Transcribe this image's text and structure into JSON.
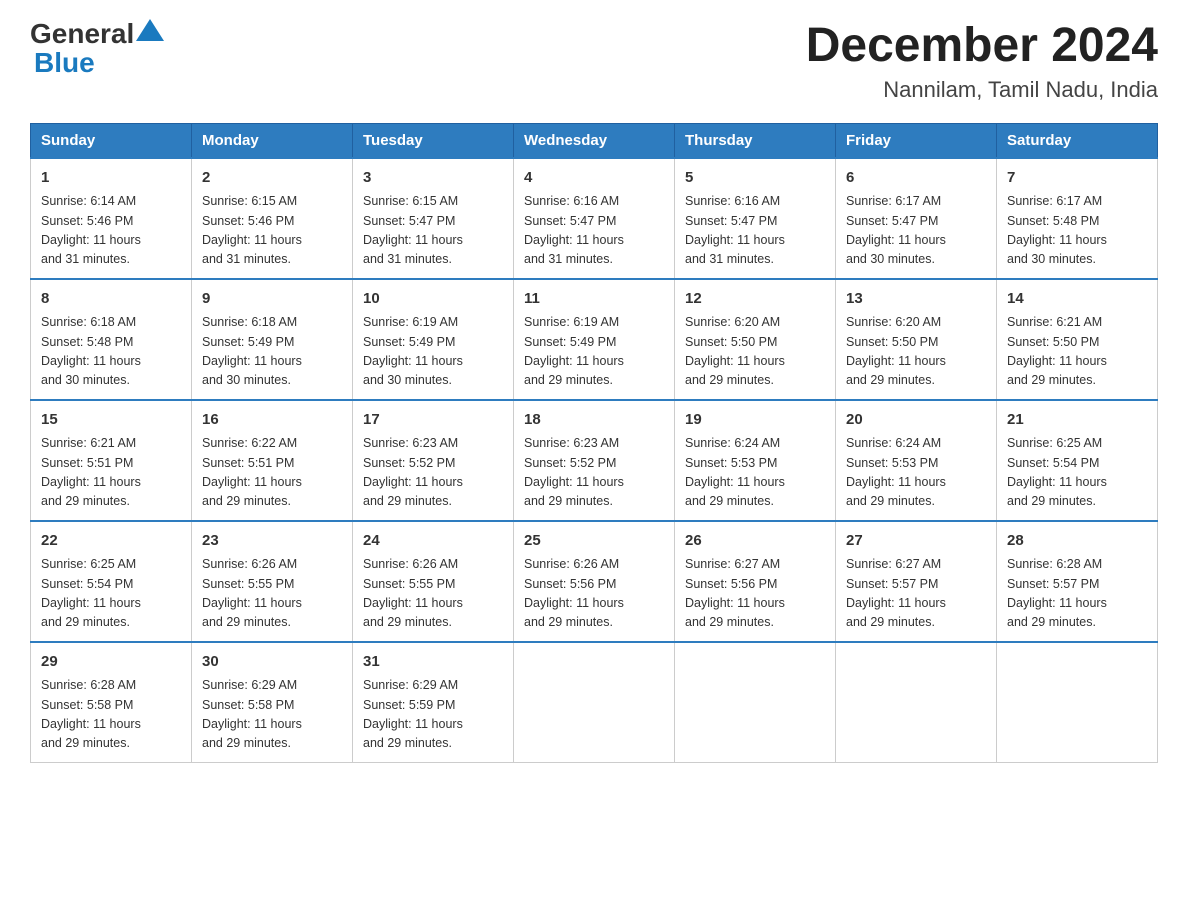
{
  "logo": {
    "line1": "General",
    "line2": "Blue"
  },
  "title": "December 2024",
  "subtitle": "Nannilam, Tamil Nadu, India",
  "headers": [
    "Sunday",
    "Monday",
    "Tuesday",
    "Wednesday",
    "Thursday",
    "Friday",
    "Saturday"
  ],
  "weeks": [
    [
      {
        "day": "1",
        "sunrise": "6:14 AM",
        "sunset": "5:46 PM",
        "daylight": "11 hours and 31 minutes."
      },
      {
        "day": "2",
        "sunrise": "6:15 AM",
        "sunset": "5:46 PM",
        "daylight": "11 hours and 31 minutes."
      },
      {
        "day": "3",
        "sunrise": "6:15 AM",
        "sunset": "5:47 PM",
        "daylight": "11 hours and 31 minutes."
      },
      {
        "day": "4",
        "sunrise": "6:16 AM",
        "sunset": "5:47 PM",
        "daylight": "11 hours and 31 minutes."
      },
      {
        "day": "5",
        "sunrise": "6:16 AM",
        "sunset": "5:47 PM",
        "daylight": "11 hours and 31 minutes."
      },
      {
        "day": "6",
        "sunrise": "6:17 AM",
        "sunset": "5:47 PM",
        "daylight": "11 hours and 30 minutes."
      },
      {
        "day": "7",
        "sunrise": "6:17 AM",
        "sunset": "5:48 PM",
        "daylight": "11 hours and 30 minutes."
      }
    ],
    [
      {
        "day": "8",
        "sunrise": "6:18 AM",
        "sunset": "5:48 PM",
        "daylight": "11 hours and 30 minutes."
      },
      {
        "day": "9",
        "sunrise": "6:18 AM",
        "sunset": "5:49 PM",
        "daylight": "11 hours and 30 minutes."
      },
      {
        "day": "10",
        "sunrise": "6:19 AM",
        "sunset": "5:49 PM",
        "daylight": "11 hours and 30 minutes."
      },
      {
        "day": "11",
        "sunrise": "6:19 AM",
        "sunset": "5:49 PM",
        "daylight": "11 hours and 29 minutes."
      },
      {
        "day": "12",
        "sunrise": "6:20 AM",
        "sunset": "5:50 PM",
        "daylight": "11 hours and 29 minutes."
      },
      {
        "day": "13",
        "sunrise": "6:20 AM",
        "sunset": "5:50 PM",
        "daylight": "11 hours and 29 minutes."
      },
      {
        "day": "14",
        "sunrise": "6:21 AM",
        "sunset": "5:50 PM",
        "daylight": "11 hours and 29 minutes."
      }
    ],
    [
      {
        "day": "15",
        "sunrise": "6:21 AM",
        "sunset": "5:51 PM",
        "daylight": "11 hours and 29 minutes."
      },
      {
        "day": "16",
        "sunrise": "6:22 AM",
        "sunset": "5:51 PM",
        "daylight": "11 hours and 29 minutes."
      },
      {
        "day": "17",
        "sunrise": "6:23 AM",
        "sunset": "5:52 PM",
        "daylight": "11 hours and 29 minutes."
      },
      {
        "day": "18",
        "sunrise": "6:23 AM",
        "sunset": "5:52 PM",
        "daylight": "11 hours and 29 minutes."
      },
      {
        "day": "19",
        "sunrise": "6:24 AM",
        "sunset": "5:53 PM",
        "daylight": "11 hours and 29 minutes."
      },
      {
        "day": "20",
        "sunrise": "6:24 AM",
        "sunset": "5:53 PM",
        "daylight": "11 hours and 29 minutes."
      },
      {
        "day": "21",
        "sunrise": "6:25 AM",
        "sunset": "5:54 PM",
        "daylight": "11 hours and 29 minutes."
      }
    ],
    [
      {
        "day": "22",
        "sunrise": "6:25 AM",
        "sunset": "5:54 PM",
        "daylight": "11 hours and 29 minutes."
      },
      {
        "day": "23",
        "sunrise": "6:26 AM",
        "sunset": "5:55 PM",
        "daylight": "11 hours and 29 minutes."
      },
      {
        "day": "24",
        "sunrise": "6:26 AM",
        "sunset": "5:55 PM",
        "daylight": "11 hours and 29 minutes."
      },
      {
        "day": "25",
        "sunrise": "6:26 AM",
        "sunset": "5:56 PM",
        "daylight": "11 hours and 29 minutes."
      },
      {
        "day": "26",
        "sunrise": "6:27 AM",
        "sunset": "5:56 PM",
        "daylight": "11 hours and 29 minutes."
      },
      {
        "day": "27",
        "sunrise": "6:27 AM",
        "sunset": "5:57 PM",
        "daylight": "11 hours and 29 minutes."
      },
      {
        "day": "28",
        "sunrise": "6:28 AM",
        "sunset": "5:57 PM",
        "daylight": "11 hours and 29 minutes."
      }
    ],
    [
      {
        "day": "29",
        "sunrise": "6:28 AM",
        "sunset": "5:58 PM",
        "daylight": "11 hours and 29 minutes."
      },
      {
        "day": "30",
        "sunrise": "6:29 AM",
        "sunset": "5:58 PM",
        "daylight": "11 hours and 29 minutes."
      },
      {
        "day": "31",
        "sunrise": "6:29 AM",
        "sunset": "5:59 PM",
        "daylight": "11 hours and 29 minutes."
      },
      null,
      null,
      null,
      null
    ]
  ],
  "labels": {
    "sunrise": "Sunrise:",
    "sunset": "Sunset:",
    "daylight": "Daylight:"
  }
}
